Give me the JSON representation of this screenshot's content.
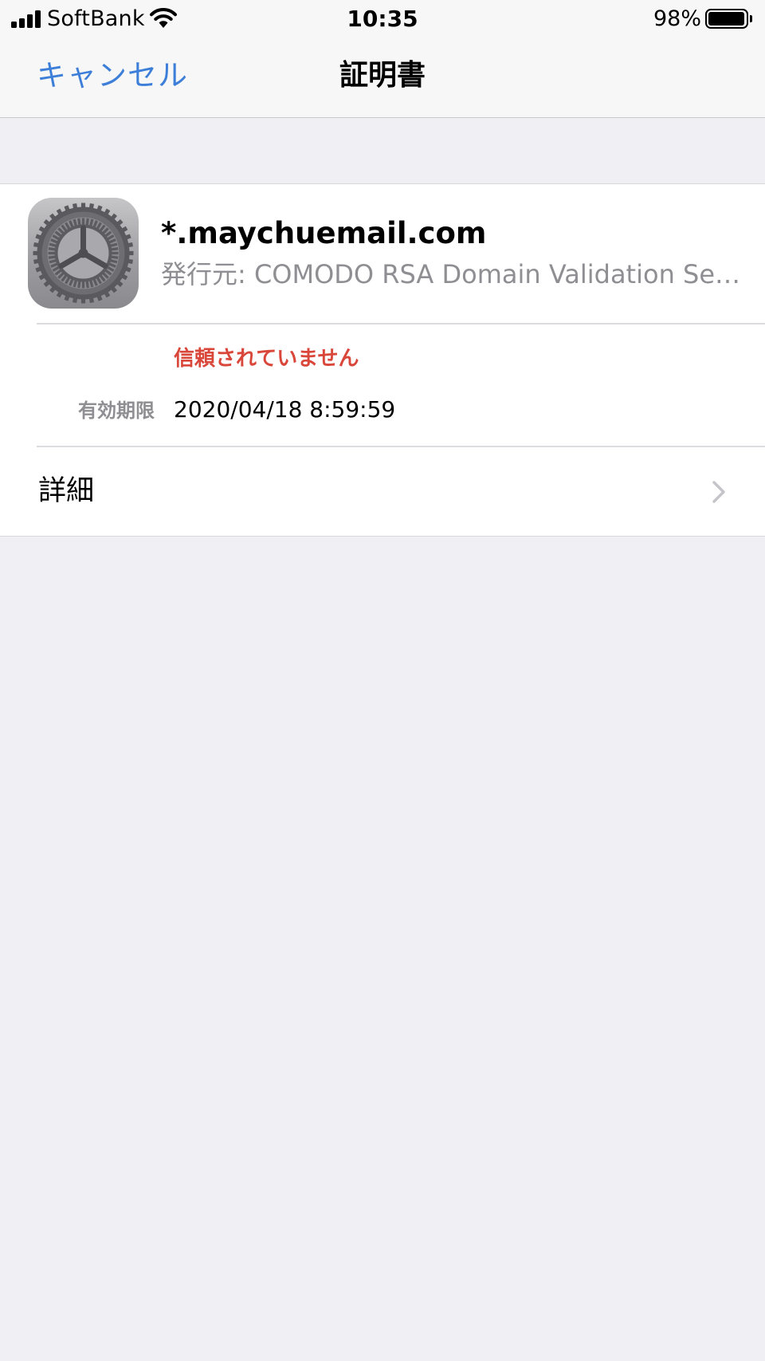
{
  "status_bar": {
    "carrier": "SoftBank",
    "time": "10:35",
    "battery_percent_label": "98%",
    "battery_level": 0.98,
    "signal_bars": 4,
    "icons": [
      "signal-icon",
      "wifi-icon",
      "battery-icon"
    ]
  },
  "nav": {
    "cancel_label": "キャンセル",
    "title": "証明書"
  },
  "certificate": {
    "icon": "settings-gear-icon",
    "name": "*.maychuemail.com",
    "issuer": "発行元: COMODO RSA Domain Validation Se…",
    "trust_status": "信頼されていません",
    "expires_label": "有効期限",
    "expires_value": "2020/04/18 8:59:59",
    "details_label": "詳細",
    "details_icon": "chevron-right-icon"
  },
  "colors": {
    "accent": "#3d7fd8",
    "warning": "#d9473a",
    "secondary_text": "#8e8e93",
    "background": "#efeff4"
  }
}
